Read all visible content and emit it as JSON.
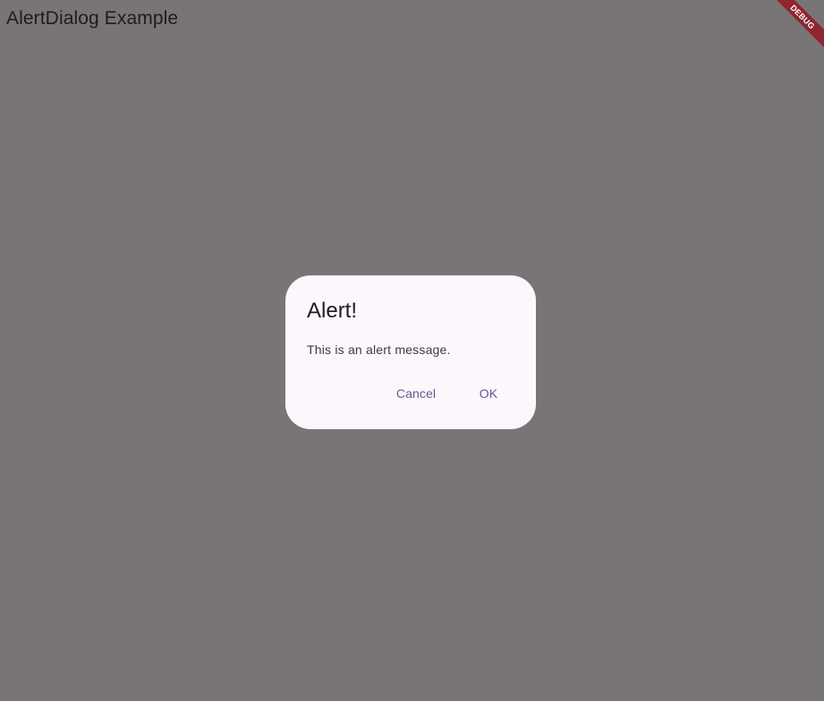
{
  "app_bar": {
    "title": "AlertDialog Example"
  },
  "debug_banner": {
    "label": "DEBUG"
  },
  "dialog": {
    "title": "Alert!",
    "message": "This is an alert message.",
    "actions": {
      "cancel_label": "Cancel",
      "ok_label": "OK"
    }
  },
  "colors": {
    "scrim": "#797476",
    "dialog_surface": "#fdf7fd",
    "primary_text": "#1f1b20",
    "action_text": "#6a558f",
    "debug_banner": "#8e2530"
  }
}
